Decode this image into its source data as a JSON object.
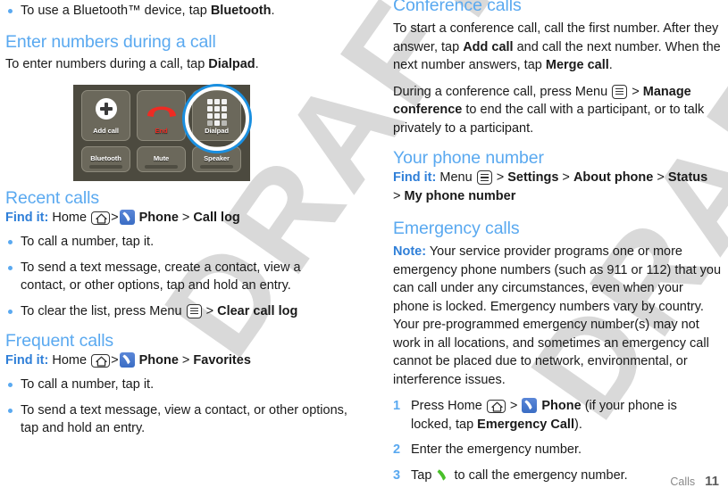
{
  "watermark": {
    "text": "DRAFT",
    "color": "#d9d9d9"
  },
  "colors": {
    "heading_blue": "#5aa9f0",
    "link_blue": "#2f7fd8",
    "bullet_blue": "#5aa9f0",
    "body_text": "#1a1a1a",
    "phone_icon_green": "#49c02a",
    "end_key_red": "#ee2b23",
    "highlight_ring": "#1a8fe0"
  },
  "left_column": {
    "intro_bullet": {
      "pre": "To use a Bluetooth™ device, tap ",
      "bold": "Bluetooth",
      "post": "."
    },
    "enter_numbers": {
      "heading": "Enter numbers during a call",
      "body_pre": "To enter numbers during a call, tap ",
      "body_bold": "Dialpad",
      "body_post": "."
    },
    "figure": {
      "name": "in-call-options-screenshot",
      "keys": [
        {
          "label": "Add call",
          "icon": "plus-icon",
          "highlighted": false
        },
        {
          "label": "End",
          "icon": "end-call-handset-icon",
          "highlighted": false
        },
        {
          "label": "Dialpad",
          "icon": "dialpad-grid-icon",
          "highlighted": true
        },
        {
          "label": "Bluetooth",
          "icon": "",
          "highlighted": false
        },
        {
          "label": "Mute",
          "icon": "",
          "highlighted": false
        },
        {
          "label": "Speaker",
          "icon": "",
          "highlighted": false
        }
      ]
    },
    "recent_calls": {
      "heading": "Recent calls",
      "find_it_label": "Find it:",
      "find_it_home": "Home",
      "find_it_gt1": ">",
      "find_it_phone": "Phone",
      "find_it_gt2": ">",
      "find_it_target": "Call log",
      "bullets": [
        {
          "pre": "To call a number, tap it.",
          "bold": "",
          "post": ""
        },
        {
          "pre": "To send a text message, create a contact, view a contact, or other options, tap and hold an entry.",
          "bold": "",
          "post": ""
        },
        {
          "pre": "To clear the list, press Menu ",
          "icon": "menu-icon",
          "mid": " > ",
          "bold": "Clear call log",
          "post": ""
        }
      ]
    },
    "frequent_calls": {
      "heading": "Frequent calls",
      "find_it_label": "Find it:",
      "find_it_home": "Home",
      "find_it_gt1": ">",
      "find_it_phone": "Phone",
      "find_it_gt2": ">",
      "find_it_target": "Favorites",
      "bullets": [
        {
          "pre": "To call a number, tap it."
        },
        {
          "pre": "To send a text message, view a contact, or other options, tap and hold an entry."
        }
      ]
    }
  },
  "right_column": {
    "conference_calls": {
      "heading": "Conference calls",
      "p1_a": "To start a conference call, call the first number. After they answer, tap ",
      "p1_b": "Add call",
      "p1_c": " and call the next number. When the next number answers, tap ",
      "p1_d": "Merge call",
      "p1_e": ".",
      "p2_a": "During a conference call, press Menu ",
      "p2_b": " > ",
      "p2_c": "Manage conference",
      "p2_d": " to end the call with a participant, or to talk privately to a participant."
    },
    "your_phone_number": {
      "heading": "Your phone number",
      "find_it_label": "Find it:",
      "find_it_menu": "Menu",
      "gt1": " > ",
      "settings": "Settings",
      "gt2": " > ",
      "about_phone": "About phone",
      "gt3": " > ",
      "status": "Status",
      "gt4": "> ",
      "my_phone_number": "My phone number"
    },
    "emergency_calls": {
      "heading": "Emergency calls",
      "note_label": "Note:",
      "note_body": " Your service provider programs one or more emergency phone numbers (such as 911 or 112) that you can call under any circumstances, even when your phone is locked. Emergency numbers vary by country. Your pre-programmed emergency number(s) may not work in all locations, and sometimes an emergency call cannot be placed due to network, environmental, or interference issues.",
      "steps": [
        {
          "num": "1",
          "a": "Press Home ",
          "gt": " > ",
          "phone": "Phone",
          "b": " (if your phone is locked, tap ",
          "bold": "Emergency Call",
          "c": ")."
        },
        {
          "num": "2",
          "a": "Enter the emergency number."
        },
        {
          "num": "3",
          "a": "Tap ",
          "b": " to call the emergency number."
        }
      ]
    }
  },
  "footer": {
    "chapter": "Calls",
    "page_number": "11"
  }
}
